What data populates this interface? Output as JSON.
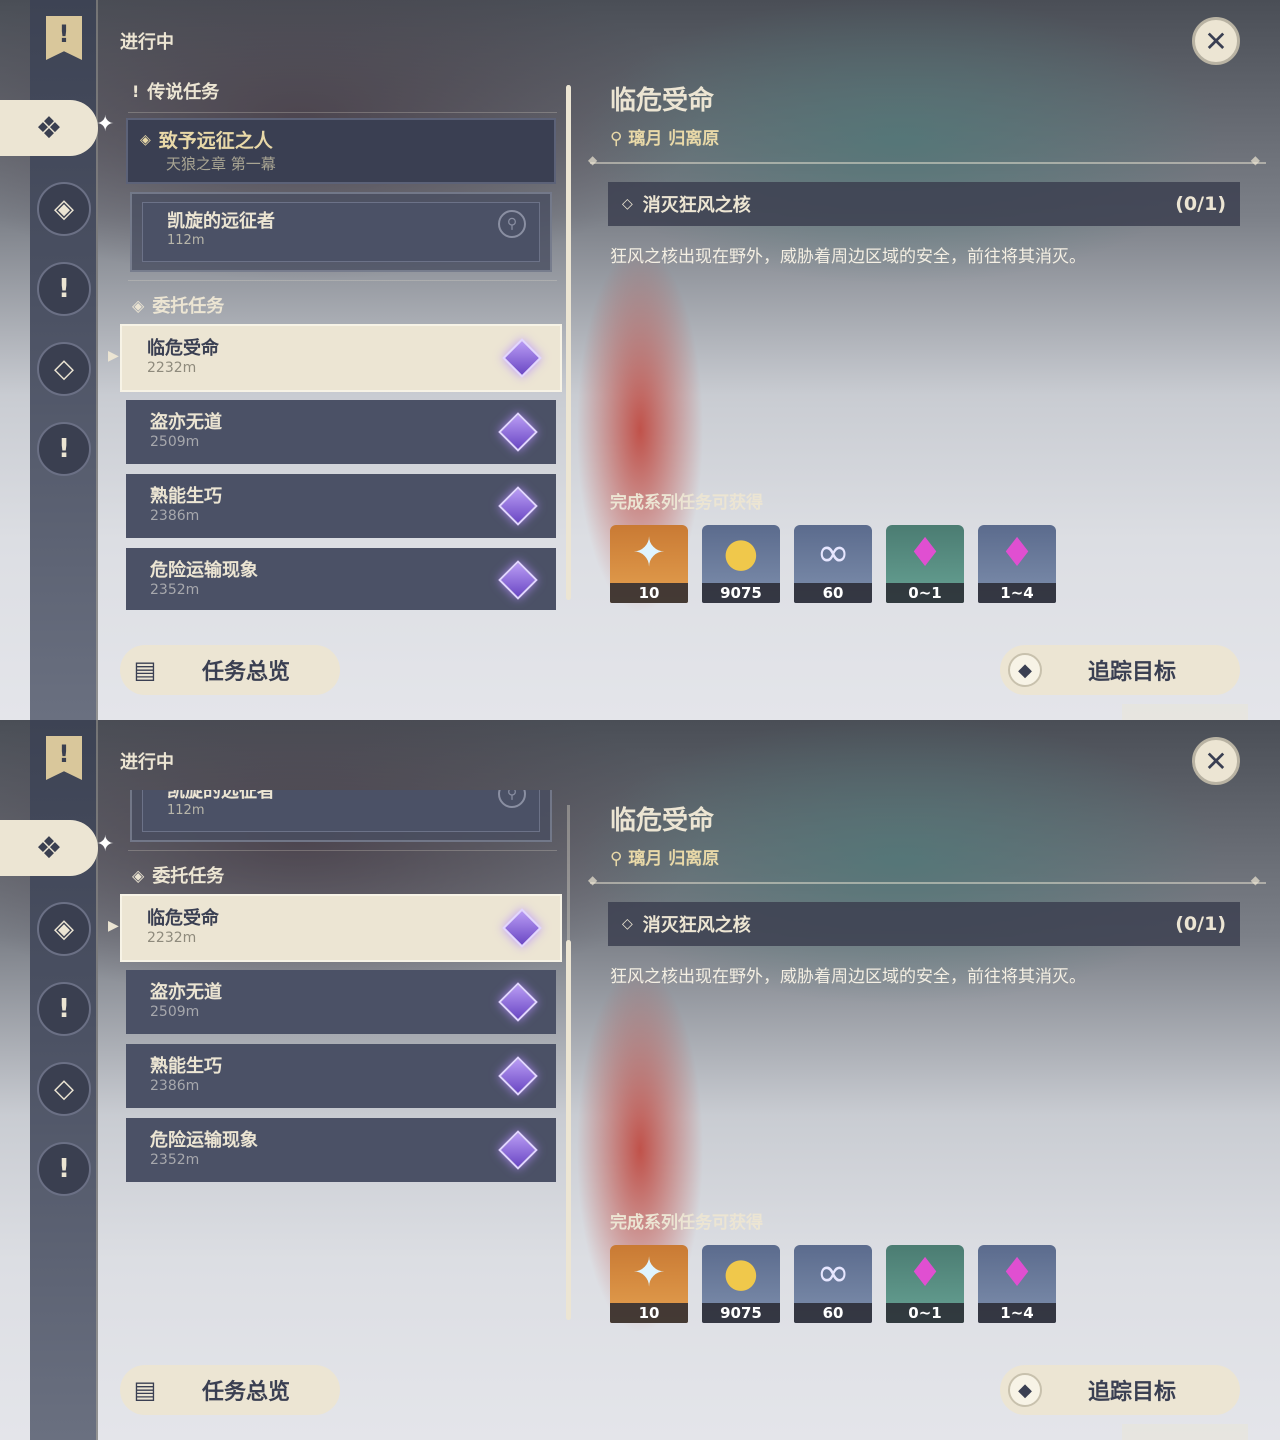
{
  "status_title": "进行中",
  "legend_section": "传说任务",
  "legend_quest": {
    "title": "致予远征之人",
    "subtitle": "天狼之章 第一幕"
  },
  "sub_step": {
    "name": "凯旋的远征者",
    "distance": "112m"
  },
  "commission_section": "委托任务",
  "commissions": [
    {
      "name": "临危受命",
      "distance": "2232m"
    },
    {
      "name": "盗亦无道",
      "distance": "2509m"
    },
    {
      "name": "熟能生巧",
      "distance": "2386m"
    },
    {
      "name": "危险运输现象",
      "distance": "2352m"
    }
  ],
  "detail": {
    "title": "临危受命",
    "location": "璃月 归离原",
    "objective": "消灭狂风之核",
    "progress": "(0/1)",
    "description": "狂风之核出现在野外，威胁着周边区域的安全，前往将其消灭。",
    "reward_title": "完成系列任务可获得",
    "rewards": [
      {
        "icon": "primogem-icon",
        "count": "10"
      },
      {
        "icon": "mora-icon",
        "count": "9075"
      },
      {
        "icon": "adventure-exp-icon",
        "count": "60"
      },
      {
        "icon": "crystal-icon",
        "count": "0~1"
      },
      {
        "icon": "crystal-cluster-icon",
        "count": "1~4"
      }
    ]
  },
  "buttons": {
    "overview": "任务总览",
    "track": "追踪目标"
  }
}
